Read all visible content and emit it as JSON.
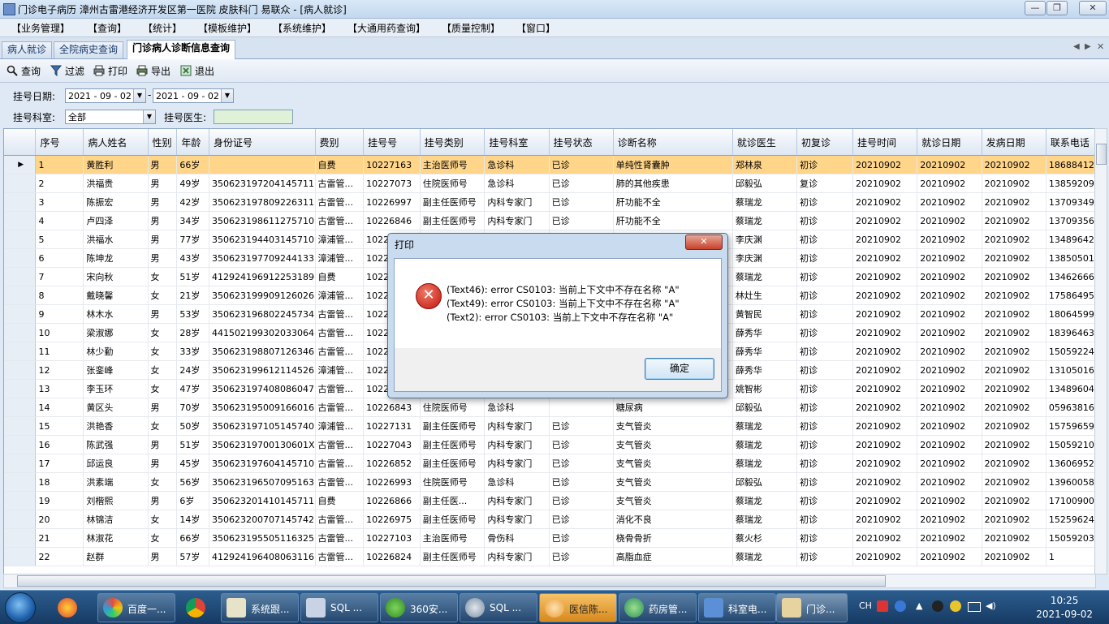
{
  "window": {
    "title": "门诊电子病历  漳州古雷港经济开发区第一医院  皮肤科门  易联众 - [病人就诊]",
    "buttons": {
      "minimize": "—",
      "maximize": "❐",
      "close": "✕"
    }
  },
  "menu": [
    "【业务管理】",
    "【查询】",
    "【统计】",
    "【模板维护】",
    "【系统维护】",
    "【大通用药查询】",
    "【质量控制】",
    "【窗口】"
  ],
  "tabs": [
    "病人就诊",
    "全院病史查询",
    "门诊病人诊断信息查询"
  ],
  "tab_nav": {
    "prev": "◀",
    "next": "▶",
    "close": "✕"
  },
  "toolbar": {
    "query": "查询",
    "filter": "过滤",
    "print": "打印",
    "export": "导出",
    "exit": "退出"
  },
  "filters": {
    "reg_date_label": "挂号日期:",
    "date_from": "2021 - 09 - 02",
    "date_sep": "-",
    "date_to": "2021 - 09 - 02",
    "dept_label": "挂号科室:",
    "dept_value": "全部",
    "doctor_label": "挂号医生:",
    "doctor_value": ""
  },
  "grid": {
    "columns": [
      "序号",
      "病人姓名",
      "性别",
      "年龄",
      "身份证号",
      "费别",
      "挂号号",
      "挂号类别",
      "挂号科室",
      "挂号状态",
      "诊断名称",
      "就诊医生",
      "初复诊",
      "挂号时间",
      "就诊日期",
      "发病日期",
      "联系电话"
    ],
    "rows": [
      [
        "1",
        "黄胜利",
        "男",
        "66岁",
        "",
        "自费",
        "10227163",
        "主治医师号",
        "急诊科",
        "已诊",
        "单纯性肾囊肿",
        "郑林泉",
        "初诊",
        "20210902",
        "20210902",
        "20210902",
        "18688412"
      ],
      [
        "2",
        "洪福贵",
        "男",
        "49岁",
        "350623197204145711",
        "古雷管...",
        "10227073",
        "住院医师号",
        "急诊科",
        "已诊",
        "肺的其他疾患",
        "邱毅弘",
        "复诊",
        "20210902",
        "20210902",
        "20210902",
        "13859209"
      ],
      [
        "3",
        "陈振宏",
        "男",
        "42岁",
        "350623197809226311",
        "古雷管...",
        "10226997",
        "副主任医师号",
        "内科专家门",
        "已诊",
        "肝功能不全",
        "蔡瑞龙",
        "初诊",
        "20210902",
        "20210902",
        "20210902",
        "13709349"
      ],
      [
        "4",
        "卢四泽",
        "男",
        "34岁",
        "350623198611275710",
        "古雷管...",
        "10226846",
        "副主任医师号",
        "内科专家门",
        "已诊",
        "肝功能不全",
        "蔡瑞龙",
        "初诊",
        "20210902",
        "20210902",
        "20210902",
        "13709356"
      ],
      [
        "5",
        "洪福水",
        "男",
        "77岁",
        "350623194403145710",
        "漳浦管...",
        "10227",
        "",
        "",
        "",
        "",
        "李庆渊",
        "初诊",
        "20210902",
        "20210902",
        "20210902",
        "13489642"
      ],
      [
        "6",
        "陈坤龙",
        "男",
        "43岁",
        "350623197709244133",
        "漳浦管...",
        "10227",
        "",
        "",
        "",
        "",
        "李庆渊",
        "初诊",
        "20210902",
        "20210902",
        "20210902",
        "13850501"
      ],
      [
        "7",
        "宋向秋",
        "女",
        "51岁",
        "412924196912253189",
        "自费",
        "1022",
        "",
        "",
        "",
        "",
        "蔡瑞龙",
        "初诊",
        "20210902",
        "20210902",
        "20210902",
        "13462666"
      ],
      [
        "8",
        "戴晓馨",
        "女",
        "21岁",
        "350623199909126026",
        "漳浦管...",
        "10227",
        "",
        "",
        "",
        "",
        "林灶生",
        "初诊",
        "20210902",
        "20210902",
        "20210902",
        "17586495"
      ],
      [
        "9",
        "林木水",
        "男",
        "53岁",
        "350623196802245734",
        "古雷管...",
        "10227",
        "",
        "",
        "",
        "",
        "黄智民",
        "初诊",
        "20210902",
        "20210902",
        "20210902",
        "18064599"
      ],
      [
        "10",
        "梁淑娜",
        "女",
        "28岁",
        "441502199302033064",
        "古雷管...",
        "10227",
        "",
        "",
        "",
        "",
        "薛秀华",
        "初诊",
        "20210902",
        "20210902",
        "20210902",
        "18396463"
      ],
      [
        "11",
        "林少勤",
        "女",
        "33岁",
        "350623198807126346",
        "古雷管...",
        "10227",
        "",
        "",
        "",
        "",
        "薛秀华",
        "初诊",
        "20210902",
        "20210902",
        "20210902",
        "15059224"
      ],
      [
        "12",
        "张銮峰",
        "女",
        "24岁",
        "350623199612114526",
        "漳浦管...",
        "10227",
        "",
        "",
        "",
        "",
        "薛秀华",
        "初诊",
        "20210902",
        "20210902",
        "20210902",
        "13105016"
      ],
      [
        "13",
        "李玉环",
        "女",
        "47岁",
        "350623197408086047",
        "古雷管...",
        "1022",
        "",
        "",
        "",
        "",
        "姚智彬",
        "初诊",
        "20210902",
        "20210902",
        "20210902",
        "13489604"
      ],
      [
        "14",
        "黄区头",
        "男",
        "70岁",
        "350623195009166016",
        "古雷管...",
        "10226843",
        "住院医师号",
        "急诊科",
        "",
        "糖尿病",
        "邱毅弘",
        "初诊",
        "20210902",
        "20210902",
        "20210902",
        "05963816"
      ],
      [
        "15",
        "洪艳香",
        "女",
        "50岁",
        "350623197105145740",
        "漳浦管...",
        "10227131",
        "副主任医师号",
        "内科专家门",
        "已诊",
        "支气管炎",
        "蔡瑞龙",
        "初诊",
        "20210902",
        "20210902",
        "20210902",
        "15759659"
      ],
      [
        "16",
        "陈武强",
        "男",
        "51岁",
        "35062319700130601X",
        "古雷管...",
        "10227043",
        "副主任医师号",
        "内科专家门",
        "已诊",
        "支气管炎",
        "蔡瑞龙",
        "初诊",
        "20210902",
        "20210902",
        "20210902",
        "15059210"
      ],
      [
        "17",
        "邱运良",
        "男",
        "45岁",
        "350623197604145710",
        "古雷管...",
        "10226852",
        "副主任医师号",
        "内科专家门",
        "已诊",
        "支气管炎",
        "蔡瑞龙",
        "初诊",
        "20210902",
        "20210902",
        "20210902",
        "13606952"
      ],
      [
        "18",
        "洪素端",
        "女",
        "56岁",
        "350623196507095163",
        "古雷管...",
        "10226993",
        "住院医师号",
        "急诊科",
        "已诊",
        "支气管炎",
        "邱毅弘",
        "初诊",
        "20210902",
        "20210902",
        "20210902",
        "13960058"
      ],
      [
        "19",
        "刘楷熙",
        "男",
        "6岁",
        "350623201410145711",
        "自费",
        "10226866",
        "副主任医...",
        "内科专家门",
        "已诊",
        "支气管炎",
        "蔡瑞龙",
        "初诊",
        "20210902",
        "20210902",
        "20210902",
        "17100900"
      ],
      [
        "20",
        "林锦洁",
        "女",
        "14岁",
        "350623200707145742",
        "古雷管...",
        "10226975",
        "副主任医师号",
        "内科专家门",
        "已诊",
        "消化不良",
        "蔡瑞龙",
        "初诊",
        "20210902",
        "20210902",
        "20210902",
        "15259624"
      ],
      [
        "21",
        "林淑花",
        "女",
        "66岁",
        "350623195505116325",
        "古雷管...",
        "10227103",
        "主治医师号",
        "骨伤科",
        "已诊",
        "桡骨骨折",
        "蔡火杉",
        "初诊",
        "20210902",
        "20210902",
        "20210902",
        "15059203"
      ],
      [
        "22",
        "赵群",
        "男",
        "57岁",
        "412924196408063116",
        "古雷管...",
        "10226824",
        "副主任医师号",
        "内科专家门",
        "已诊",
        "高脂血症",
        "蔡瑞龙",
        "初诊",
        "20210902",
        "20210902",
        "20210902",
        "1"
      ]
    ]
  },
  "dialog": {
    "title": "打印",
    "close": "✕",
    "messages": [
      "(Text46): error CS0103: 当前上下文中不存在名称 \"A\"",
      "(Text49): error CS0103: 当前上下文中不存在名称 \"A\"",
      "(Text2): error CS0103: 当前上下文中不存在名称 \"A\""
    ],
    "ok": "确定"
  },
  "taskbar": {
    "apps": [
      "百度一...",
      "系统跟...",
      "SQL ...",
      "360安...",
      "SQL ...",
      "医信陈...",
      "药房管...",
      "科室电...",
      "门诊..."
    ],
    "tray": {
      "lang": "CH"
    },
    "time": "10:25",
    "date": "2021-09-02"
  }
}
